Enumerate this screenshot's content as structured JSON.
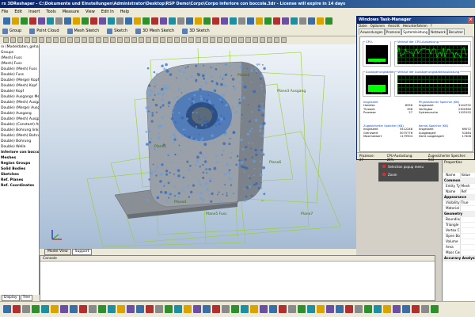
{
  "window_title": "rx 3DReshaper - C:\\Dokumente und Einstellungen\\Administrator\\Desktop\\RSP Demo\\Corpo\\Corpo inferiore con boccola.3dr - License will expire in 14 days",
  "menu": [
    "File",
    "Edit",
    "Insert",
    "Tools",
    "Measure",
    "View",
    "Edit In",
    "Help"
  ],
  "toolbar_labels": [
    "Group",
    "Point Cloud",
    "Mesh Sketch",
    "Sketch",
    "3D Mesh Sketch",
    "3D Sketch"
  ],
  "tree": {
    "items": [
      {
        "label": "rx (Modeldaten_gehause",
        "bold": false
      },
      {
        "label": "Groups",
        "bold": false
      },
      {
        "label": "(Mesh) Fuss",
        "bold": false
      },
      {
        "label": "(Mesh) Fuss",
        "bold": false
      },
      {
        "label": "Double) (Mesh) Fuss",
        "bold": false
      },
      {
        "label": "Double) Fuss",
        "bold": false
      },
      {
        "label": "Double) (Merge) Kopf",
        "bold": false
      },
      {
        "label": "Double) (Mesh) Kopf",
        "bold": false
      },
      {
        "label": "Double) Kopf",
        "bold": false
      },
      {
        "label": "Double) Ausgangs Mem",
        "bold": false
      },
      {
        "label": "Double) (Mesh) Ausgang",
        "bold": false
      },
      {
        "label": "Double) (Merge) Ausgang",
        "bold": false
      },
      {
        "label": "Double) Ausgang",
        "bold": false
      },
      {
        "label": "Double) (Mesh) Ausgang",
        "bold": false
      },
      {
        "label": "Double) (Constant) Ausgang",
        "bold": false
      },
      {
        "label": "Double) Bohrung links",
        "bold": false
      },
      {
        "label": "Double) (Mesh) Bohrung",
        "bold": false
      },
      {
        "label": "Double) Bohrung",
        "bold": false
      },
      {
        "label": "Double) Welle",
        "bold": false
      },
      {
        "label": "Inferiore con boccola",
        "bold": true
      },
      {
        "label": "Meshes",
        "bold": true
      },
      {
        "label": "Region Groups",
        "bold": true
      },
      {
        "label": "Solid Bodies",
        "bold": true
      },
      {
        "label": "Sketches",
        "bold": true
      },
      {
        "label": "Ref. Planes",
        "bold": true
      },
      {
        "label": "Ref. Coordinates",
        "bold": true
      }
    ],
    "tabs": [
      "Display",
      "Tree"
    ]
  },
  "viewport": {
    "plane_labels": [
      "Plane1",
      "Plane2",
      "Plane3 Ausgang",
      "Plane4",
      "Plane5 Fuss",
      "Plane6",
      "Plane7"
    ],
    "tabs": [
      "Model View",
      "Support"
    ]
  },
  "console": {
    "title": "Console"
  },
  "task_manager": {
    "title": "Windows Task-Manager",
    "menu": [
      "Datei",
      "Optionen",
      "Ansicht",
      "Herunterfahren",
      "?"
    ],
    "tabs": [
      "Anwendungen",
      "Prozesse",
      "Systemleistung",
      "Netzwerk",
      "Benutzer"
    ],
    "active_tab": "Systemleistung",
    "graph_labels": {
      "cpu": "CPU-Auslastung",
      "cpu_history": "Verlauf der CPU-Auslastung",
      "memory": "Auslagerungsdatei",
      "memory_history": "Verlauf der Auslagerungsdateiauslastung"
    },
    "cpu_value": "25 %",
    "cpu_fraction": 0.25,
    "mem_value": "2,10 GB",
    "mem_fraction": 0.55,
    "totals": {
      "title": "Insgesamt",
      "rows": [
        [
          "Handles",
          "8956"
        ],
        [
          "Threads",
          "398"
        ],
        [
          "Prozesse",
          "27"
        ]
      ]
    },
    "physical": {
      "title": "Physikalischer Speicher (KB)",
      "rows": [
        [
          "Insgesamt",
          "3144792"
        ],
        [
          "Verfügbar",
          "2300360"
        ],
        [
          "Systemcache",
          "1105192"
        ]
      ]
    },
    "commit": {
      "title": "Zugesicherter Speicher (KB)",
      "rows": [
        [
          "Insgesamt",
          "5512248"
        ],
        [
          "Grenzwert",
          "5075776"
        ],
        [
          "Maximalwert",
          "1179904"
        ]
      ]
    },
    "kernel": {
      "title": "Kernel-Speicher (KB)",
      "rows": [
        [
          "Insgesamt",
          "69072"
        ],
        [
          "Ausgelagert",
          "51464"
        ],
        [
          "Nicht ausgelagert",
          "17408"
        ]
      ]
    },
    "status": [
      "Prozesse: 27",
      "CPU-Auslastung: 25%",
      "Zugesicherter Speicher: 933"
    ]
  },
  "popup": {
    "items": [
      "Selection popup menu",
      "Zoom"
    ]
  },
  "properties": {
    "header": "Properties",
    "rows": [
      {
        "type": "col",
        "k": "Name",
        "v": "Value"
      },
      {
        "type": "sec",
        "k": "Common"
      },
      {
        "type": "row",
        "k": "Entity Type",
        "v": "Mesh"
      },
      {
        "type": "row",
        "k": "Name",
        "v": "Ref"
      },
      {
        "type": "sec",
        "k": "Appearance"
      },
      {
        "type": "row",
        "k": "Visibility",
        "v": "True"
      },
      {
        "type": "row",
        "k": "Material",
        "v": ""
      },
      {
        "type": "sec",
        "k": "Geometry"
      },
      {
        "type": "row",
        "k": "Bounding",
        "v": ""
      },
      {
        "type": "row",
        "k": "Triangle Co",
        "v": ""
      },
      {
        "type": "row",
        "k": "Vertex Co",
        "v": ""
      },
      {
        "type": "row",
        "k": "Open Bou",
        "v": ""
      },
      {
        "type": "row",
        "k": "Volume",
        "v": ""
      },
      {
        "type": "row",
        "k": "Area",
        "v": ""
      },
      {
        "type": "row",
        "k": "Mass Cen",
        "v": ""
      },
      {
        "type": "sec",
        "k": "Accuracy Analysis"
      }
    ]
  }
}
